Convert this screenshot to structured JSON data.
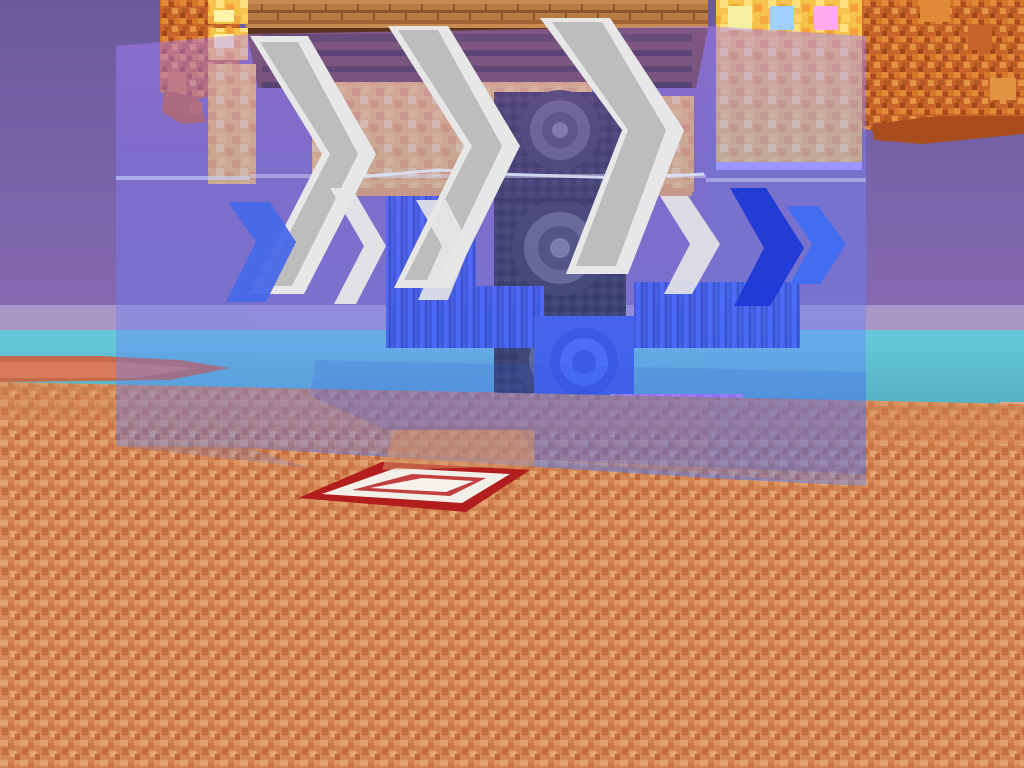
{
  "scene": {
    "palette": {
      "sky_top": "#6b5a9e",
      "sky_mid": "#8c6fb8",
      "sky_low": "#b28bd1",
      "haze": "#c6b9d6",
      "ocean": "#4aa6b8",
      "ocean_far": "#67c7d8",
      "terracotta_base": "#d28552",
      "terracotta_light": "#e5a070",
      "terracotta_dark": "#b86c42",
      "autumn_leaves": "#d7772b",
      "autumn_leaves_dark": "#a94d1f",
      "glass_blue": "#4c7cff",
      "glass_purple": "#b083ff",
      "glowstone_yellow": "#f6c34a",
      "glowstone_orange": "#f2a23a",
      "dark_wood": "#4a2e1a",
      "plank": "#b87b43",
      "plank_dark": "#8a552c",
      "speaker_black": "#222222",
      "speaker_gray": "#666666",
      "arrow_white": "#e7e7e7",
      "arrow_shadow": "#bdbdbd",
      "blue_wool": "#2e4fda",
      "blue_wool_dark": "#1f37a8",
      "pink_wool": "#e38cff",
      "pressure_plate_red": "#b21d1d",
      "pressure_plate_white": "#f2efe9"
    },
    "icons": {
      "left_tree": "leaf-canopy-icon",
      "right_tree": "leaf-canopy-icon",
      "speaker": "speaker-icon",
      "arrow": "chevron-right-icon",
      "pressure_plate": "pressure-plate-icon"
    }
  }
}
